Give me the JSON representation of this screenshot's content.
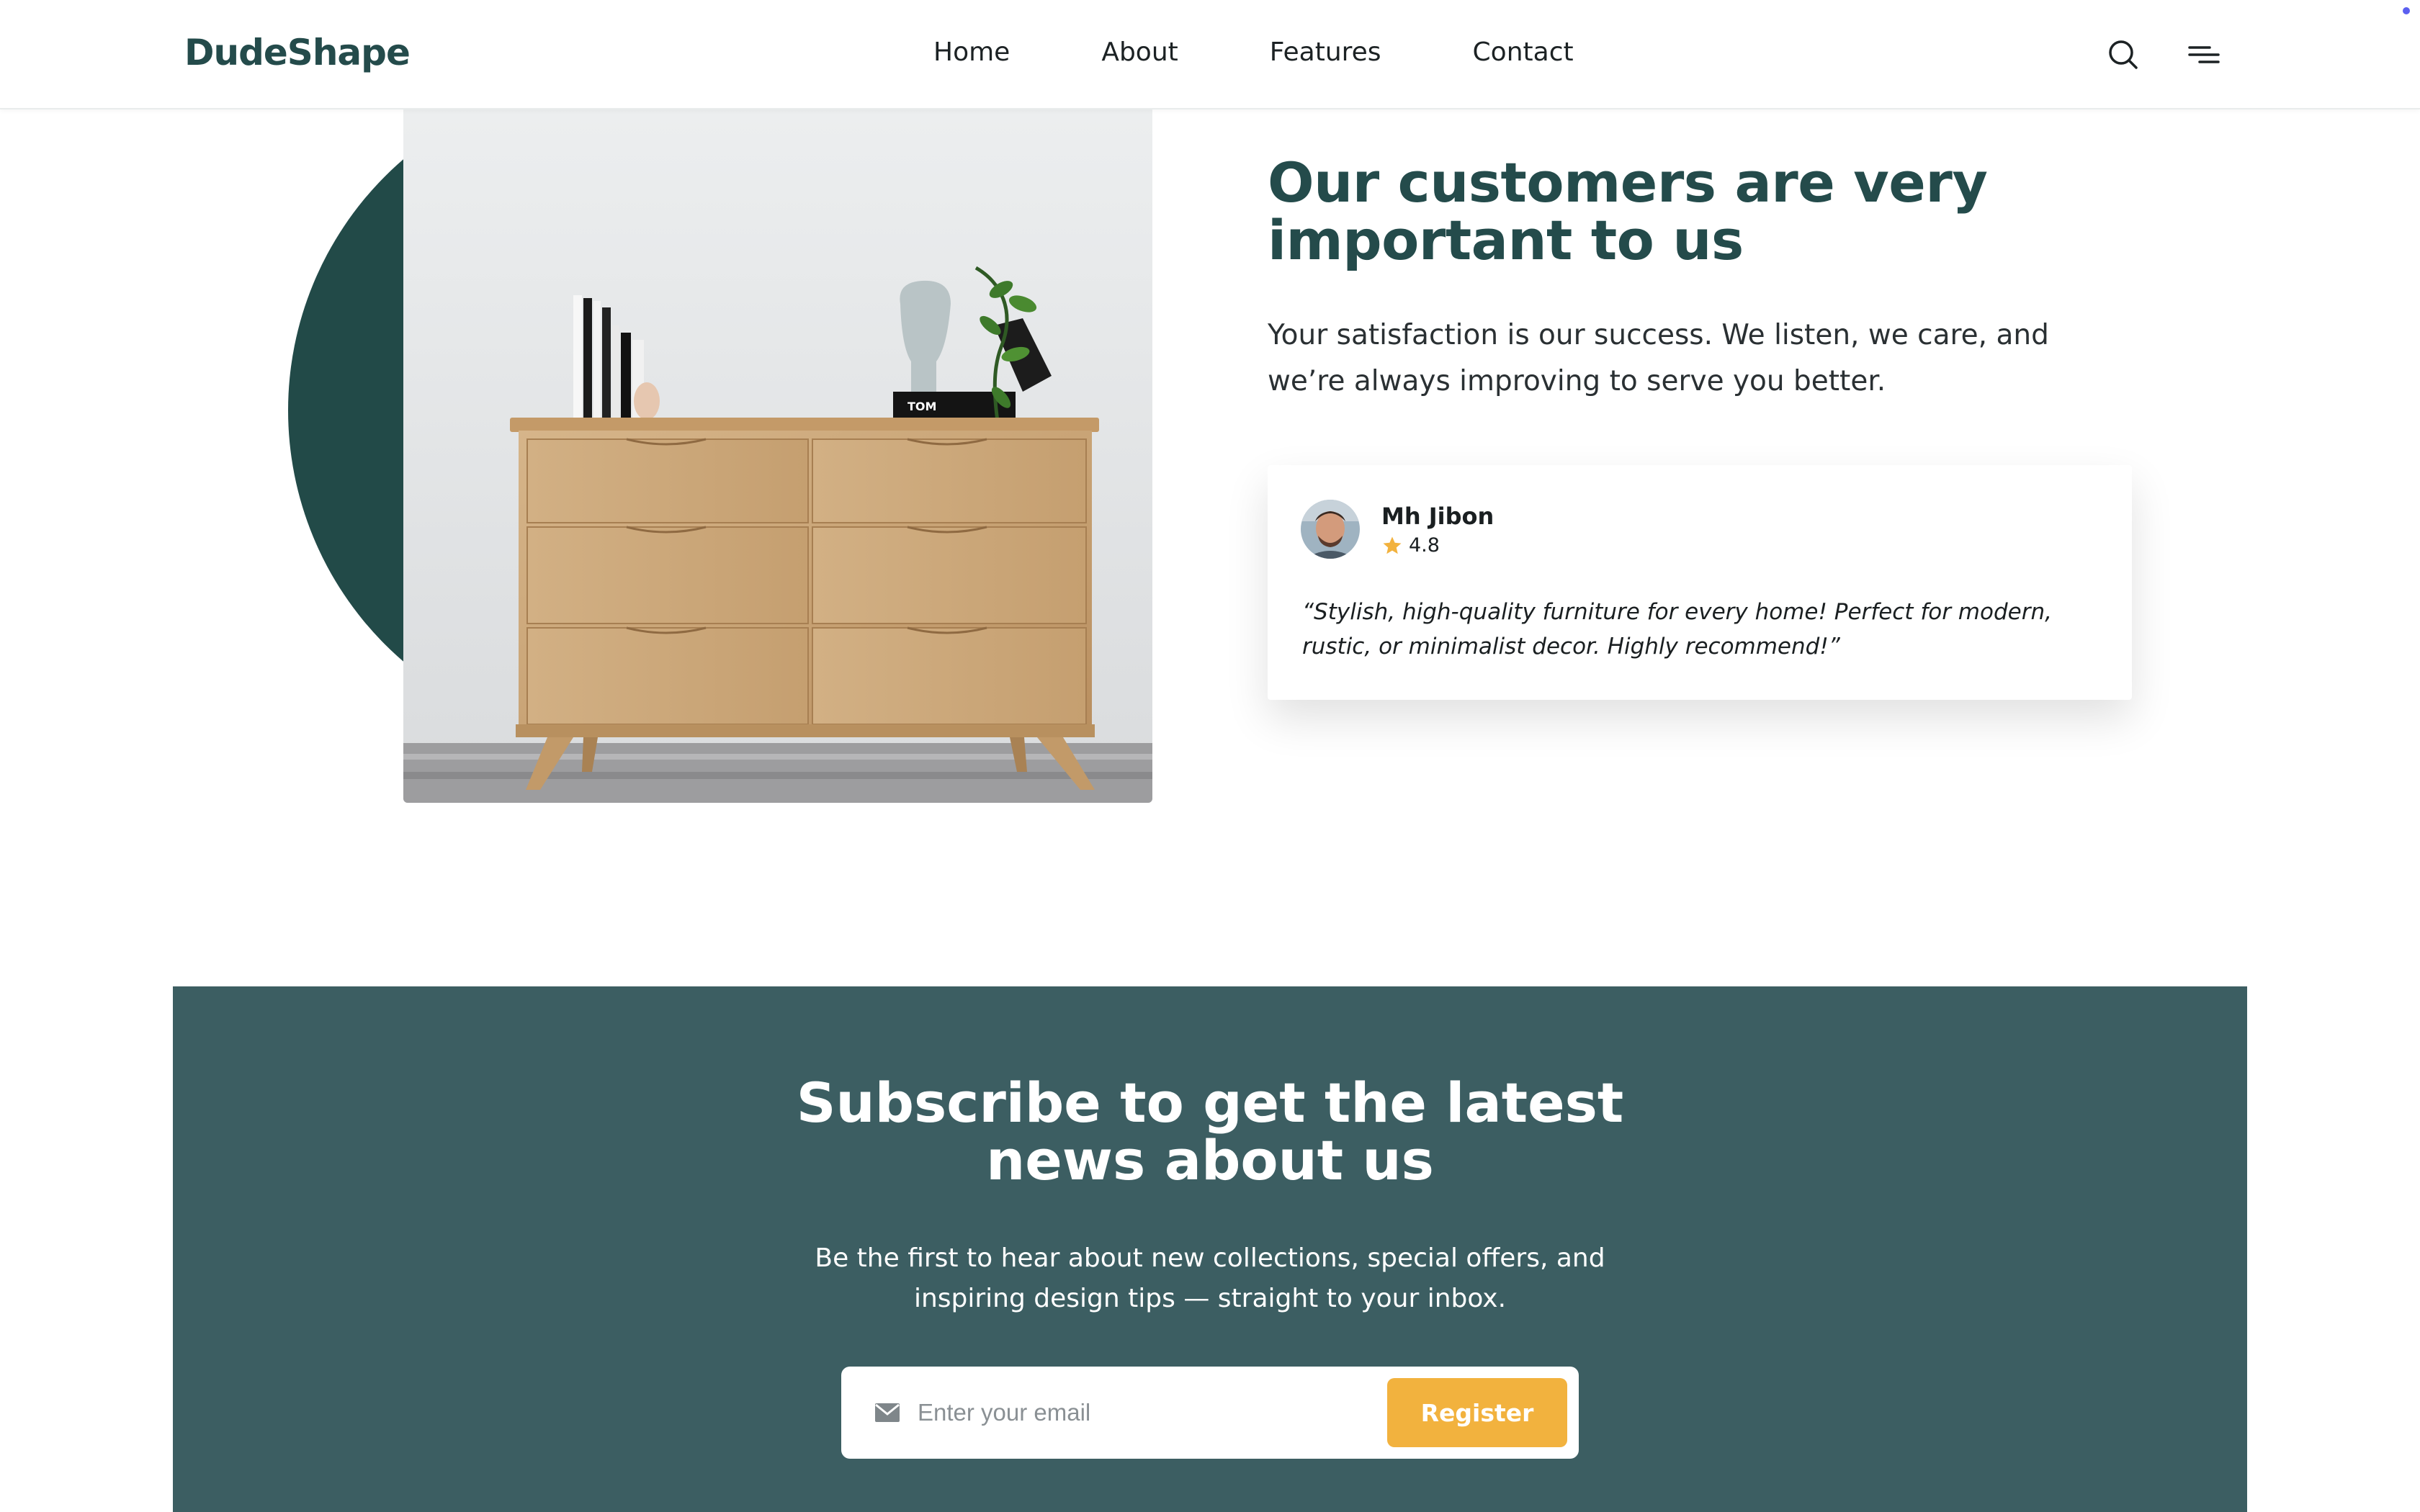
{
  "brand": {
    "name": "DudeShape",
    "accent": "#244b4b",
    "button_color": "#f2b23e",
    "subscribe_bg": "#3c5e62"
  },
  "nav": {
    "items": [
      "Home",
      "About",
      "Features",
      "Contact"
    ]
  },
  "header_icons": {
    "search": "search-icon",
    "menu": "menu-icon"
  },
  "customers": {
    "title": "Our customers are very important to us",
    "text": "Your satisfaction is our success. We listen, we care, and we’re always improving to serve you better.",
    "image": "wooden-dresser-photo"
  },
  "review": {
    "name": "Mh Jibon",
    "rating": "4.8",
    "quote": "“Stylish, high-quality furniture for every home! Perfect for modern, rustic, or minimalist decor. Highly recommend!”"
  },
  "subscribe": {
    "title_line1": "Subscribe to get the latest",
    "title_line2": "news about us",
    "text": "Be the first to hear about new collections, special offers, and inspiring design tips — straight to your inbox.",
    "email_placeholder": "Enter your email",
    "button": "Register"
  }
}
